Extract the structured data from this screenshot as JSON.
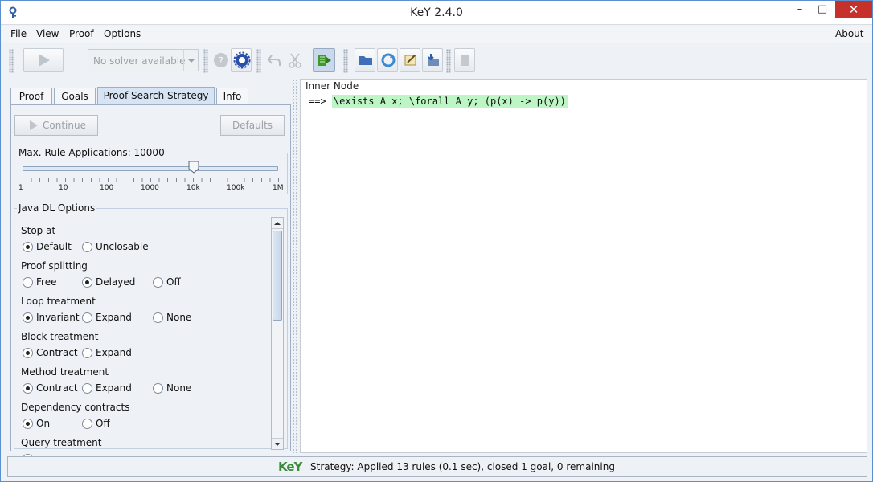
{
  "window": {
    "title": "KeY 2.4.0"
  },
  "menu": {
    "file": "File",
    "view": "View",
    "proof": "Proof",
    "options": "Options",
    "about": "About"
  },
  "toolbar": {
    "solver_label": "No solver available"
  },
  "tabs": {
    "proof": "Proof",
    "goals": "Goals",
    "strategy": "Proof Search Strategy",
    "info": "Info"
  },
  "strategy": {
    "continue_label": "Continue",
    "defaults_label": "Defaults",
    "max_rule_label": "Max. Rule Applications: 10000",
    "slider_value": 10000,
    "slider_ticks": [
      "1",
      "10",
      "100",
      "1000",
      "10k",
      "100k",
      "1M"
    ],
    "java_dl_label": "Java DL Options",
    "options": {
      "stop_at": {
        "label": "Stop at",
        "choices": [
          "Default",
          "Unclosable"
        ]
      },
      "proof_splitting": {
        "label": "Proof splitting",
        "choices": [
          "Free",
          "Delayed",
          "Off"
        ]
      },
      "loop_treatment": {
        "label": "Loop treatment",
        "choices": [
          "Invariant",
          "Expand",
          "None"
        ]
      },
      "block_treatment": {
        "label": "Block treatment",
        "choices": [
          "Contract",
          "Expand"
        ]
      },
      "method_treatment": {
        "label": "Method treatment",
        "choices": [
          "Contract",
          "Expand",
          "None"
        ]
      },
      "dependency_contracts": {
        "label": "Dependency contracts",
        "choices": [
          "On",
          "Off"
        ]
      },
      "query_treatment": {
        "label": "Query treatment"
      }
    }
  },
  "inner_node": {
    "label": "Inner Node",
    "arrow": "==>",
    "formula": "\\exists A x; \\forall A y; (p(x) -> p(y))"
  },
  "status": {
    "text": "Strategy: Applied 13 rules (0.1 sec),  closed 1 goal, 0 remaining",
    "logo": "KeY"
  }
}
